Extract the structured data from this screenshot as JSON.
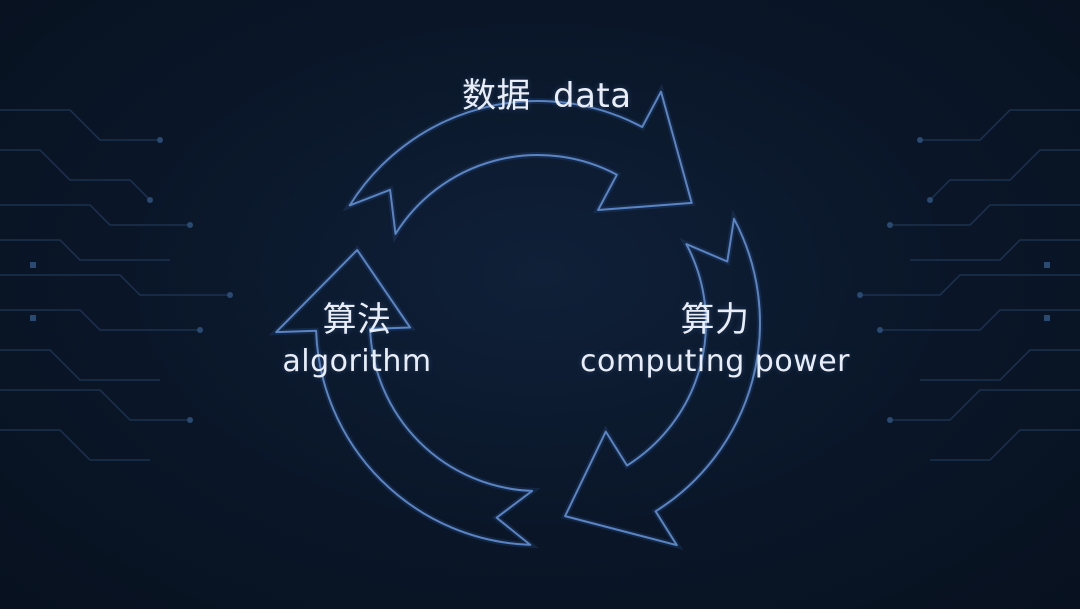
{
  "diagram": {
    "nodes": [
      {
        "id": "data",
        "zh": "数据",
        "en": "data"
      },
      {
        "id": "computing",
        "zh": "算力",
        "en": "computing power"
      },
      {
        "id": "algorithm",
        "zh": "算法",
        "en": "algorithm"
      }
    ],
    "cycle_order": [
      "data",
      "computing",
      "algorithm"
    ],
    "colors": {
      "background": "#0a1628",
      "arrow_stroke": "#5b84c4",
      "circuit": "#1f3553",
      "text": "#e9eef6"
    }
  }
}
